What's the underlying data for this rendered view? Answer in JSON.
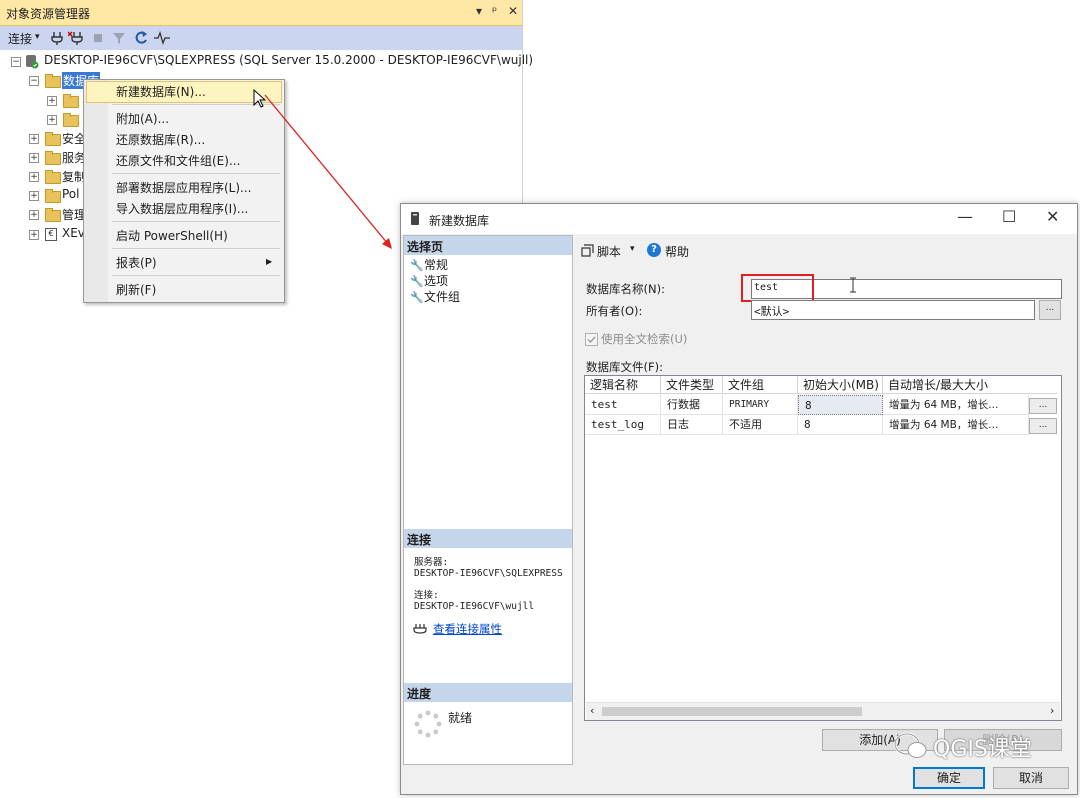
{
  "object_explorer": {
    "title": "对象资源管理器",
    "title_controls": [
      "▾",
      "ᵖ",
      "✕"
    ],
    "toolbar": {
      "connect": "连接",
      "connect_arrow": "▾"
    },
    "server_node": "DESKTOP-IE96CVF\\SQLEXPRESS (SQL Server 15.0.2000 - DESKTOP-IE96CVF\\wujll)",
    "databases_node": "数据库",
    "nodes": [
      "安全",
      "服务",
      "复制",
      "Pol",
      "管理",
      "XEv"
    ]
  },
  "context_menu": {
    "items": [
      "新建数据库(N)...",
      "附加(A)...",
      "还原数据库(R)...",
      "还原文件和文件组(E)...",
      "部署数据层应用程序(L)...",
      "导入数据层应用程序(I)...",
      "启动 PowerShell(H)",
      "报表(P)",
      "刷新(F)"
    ],
    "submenu_arrow": "▶"
  },
  "dialog": {
    "title": "新建数据库",
    "window_buttons": {
      "minimize": "—",
      "maximize": "☐",
      "close": "✕"
    },
    "left": {
      "select_page_header": "选择页",
      "pages": [
        "常规",
        "选项",
        "文件组"
      ],
      "connection_header": "连接",
      "server_label": "服务器:",
      "server_value": "DESKTOP-IE96CVF\\SQLEXPRESS",
      "connection_label": "连接:",
      "connection_value": "DESKTOP-IE96CVF\\wujll",
      "view_props_link": "查看连接属性",
      "progress_header": "进度",
      "progress_status": "就绪"
    },
    "toolbar": {
      "script": "脚本",
      "script_arrow": "▾",
      "help": "帮助"
    },
    "form": {
      "db_name_label": "数据库名称(N):",
      "db_name_value": "test",
      "owner_label": "所有者(O):",
      "owner_value": "<默认>",
      "owner_button": "...",
      "fulltext_label": "使用全文检索(U)",
      "fulltext_checked": true,
      "files_label": "数据库文件(F):"
    },
    "files_table": {
      "columns": [
        "逻辑名称",
        "文件类型",
        "文件组",
        "初始大小(MB)",
        "自动增长/最大大小"
      ],
      "rows": [
        [
          "test",
          "行数据",
          "PRIMARY",
          "8",
          "增量为 64 MB，增长..."
        ],
        [
          "test_log",
          "日志",
          "不适用",
          "8",
          "增量为 64 MB，增长..."
        ]
      ],
      "row_button": "..."
    },
    "buttons": {
      "add": "添加(A)",
      "remove": "删除(R)",
      "ok": "确定",
      "cancel": "取消"
    }
  },
  "watermark": "QGIS课堂",
  "colors": {
    "oe_title_bg": "#ffe8a6",
    "oe_toolbar_bg": "#ccd5f0",
    "menu_highlight": "#fdf4bf",
    "section_header_bg": "#c6d6ea",
    "annotation_red": "#e02020",
    "link_blue": "#0044cc"
  }
}
